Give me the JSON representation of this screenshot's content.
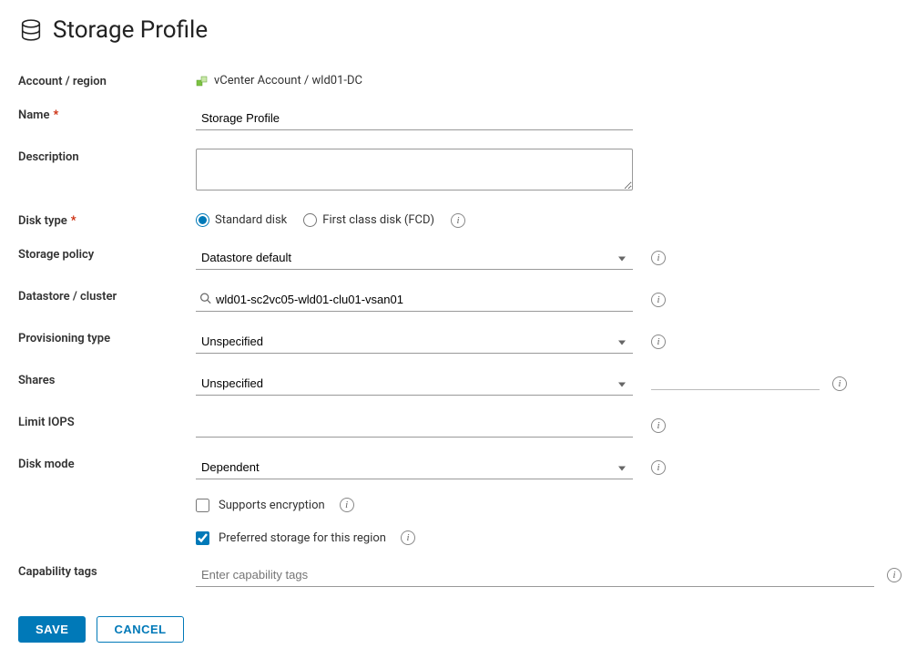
{
  "header": {
    "title": "Storage Profile"
  },
  "labels": {
    "account_region": "Account / region",
    "name": "Name",
    "description": "Description",
    "disk_type": "Disk type",
    "storage_policy": "Storage policy",
    "datastore_cluster": "Datastore / cluster",
    "provisioning_type": "Provisioning type",
    "shares": "Shares",
    "limit_iops": "Limit IOPS",
    "disk_mode": "Disk mode",
    "capability_tags": "Capability tags"
  },
  "values": {
    "account_region": "vCenter Account / wld01-DC",
    "name": "Storage Profile",
    "description": "",
    "disk_type": "standard",
    "storage_policy": "Datastore default",
    "datastore_cluster": "wld01-sc2vc05-wld01-clu01-vsan01",
    "provisioning_type": "Unspecified",
    "shares": "Unspecified",
    "shares_value": "",
    "limit_iops": "",
    "disk_mode": "Dependent",
    "supports_encryption": false,
    "preferred_storage": true,
    "capability_tags": ""
  },
  "options": {
    "disk_type": {
      "standard": "Standard disk",
      "fcd": "First class disk (FCD)"
    },
    "supports_encryption_label": "Supports encryption",
    "preferred_storage_label": "Preferred storage for this region",
    "capability_tags_placeholder": "Enter capability tags"
  },
  "buttons": {
    "save": "SAVE",
    "cancel": "CANCEL"
  }
}
